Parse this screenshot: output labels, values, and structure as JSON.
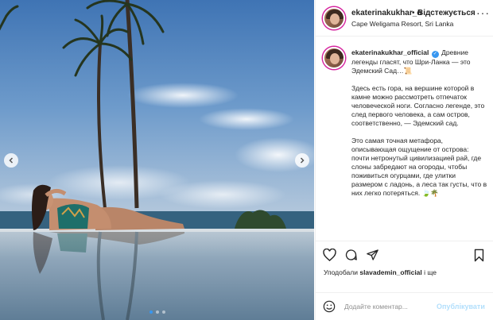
{
  "post": {
    "username": "ekaterinakukhar_official",
    "username_truncated": "ekaterinakukhar_o",
    "separator": "•",
    "follow_label": "Відстежується",
    "location": "Cape Weligama Resort, Sri Lanka",
    "more_label": "···"
  },
  "caption": {
    "author": "ekaterinakukhar_official",
    "verified_mark": "✓",
    "first": "Древние легенды гласят, что Шри-Ланка — это Эдемский Сад…📜",
    "second": "Здесь есть гора, на вершине которой в камне можно рассмотреть отпечаток человеческой ноги. Согласно легенде, это след первого человека, а сам остров, соответственно, — Эдемский сад.",
    "third": "Это самая точная метафора, описывающая ощущение от острова: почти нетронутый цивилизацией рай, где слоны забредают на огороды, чтобы поживиться огурцами, где улитки размером с ладонь, а леса так густы, что в них легко потеряться. 🍃🌴"
  },
  "actions": {
    "like_icon": "heart-icon",
    "comment_icon": "comment-icon",
    "share_icon": "share-icon",
    "save_icon": "bookmark-icon"
  },
  "likes": {
    "prefix": "Уподобали",
    "user": "slavademin_official",
    "suffix": "і ще"
  },
  "comment_box": {
    "placeholder": "Додайте коментар...",
    "post_label": "Опублікувати"
  },
  "carousel": {
    "slides": 3,
    "active_index": 1
  },
  "colors": {
    "accent": "#3897f0",
    "post_disabled": "#b2dffc",
    "border": "#efefef",
    "text": "#262626"
  }
}
